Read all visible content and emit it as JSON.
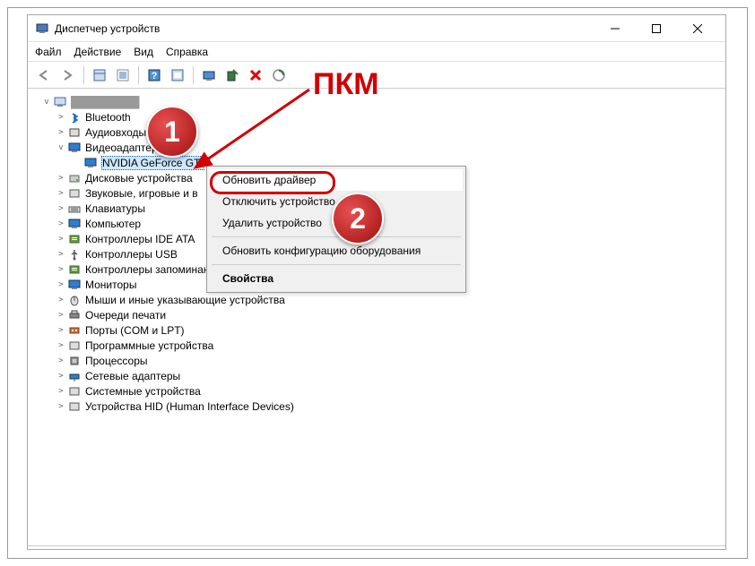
{
  "title": "Диспетчер устройств",
  "menus": {
    "file": "Файл",
    "action": "Действие",
    "view": "Вид",
    "help": "Справка"
  },
  "toolbar": {
    "back": "←",
    "forward": "→",
    "icons": [
      "props",
      "scan",
      "help",
      "show",
      "monitor",
      "install",
      "delete",
      "scan2"
    ]
  },
  "tree": {
    "root": "",
    "items": [
      {
        "label": "Bluetooth",
        "expanded": false,
        "icon": "bluetooth"
      },
      {
        "label": "Аудиовходы",
        "expanded": false,
        "icon": "audio",
        "trail": "ды"
      },
      {
        "label": "Видеоадаптеры",
        "expanded": true,
        "icon": "display",
        "children": [
          {
            "label": "NVIDIA GeForce GT",
            "icon": "display",
            "selected": true
          }
        ]
      },
      {
        "label": "Дисковые устройства",
        "expanded": false,
        "icon": "disk"
      },
      {
        "label": "Звуковые, игровые и в",
        "expanded": false,
        "icon": "sound"
      },
      {
        "label": "Клавиатуры",
        "expanded": false,
        "icon": "keyboard"
      },
      {
        "label": "Компьютер",
        "expanded": false,
        "icon": "computer"
      },
      {
        "label": "Контроллеры IDE ATA",
        "expanded": false,
        "icon": "ide"
      },
      {
        "label": "Контроллеры USB",
        "expanded": false,
        "icon": "usb"
      },
      {
        "label": "Контроллеры запоминающих устройств",
        "expanded": false,
        "icon": "storage"
      },
      {
        "label": "Мониторы",
        "expanded": false,
        "icon": "monitor"
      },
      {
        "label": "Мыши и иные указывающие устройства",
        "expanded": false,
        "icon": "mouse"
      },
      {
        "label": "Очереди печати",
        "expanded": false,
        "icon": "printer"
      },
      {
        "label": "Порты (COM и LPT)",
        "expanded": false,
        "icon": "port"
      },
      {
        "label": "Программные устройства",
        "expanded": false,
        "icon": "software"
      },
      {
        "label": "Процессоры",
        "expanded": false,
        "icon": "cpu"
      },
      {
        "label": "Сетевые адаптеры",
        "expanded": false,
        "icon": "network"
      },
      {
        "label": "Системные устройства",
        "expanded": false,
        "icon": "system"
      },
      {
        "label": "Устройства HID (Human Interface Devices)",
        "expanded": false,
        "icon": "hid"
      }
    ]
  },
  "context_menu": {
    "items": [
      "Обновить драйвер",
      "Отключить устройство",
      "Удалить устройство",
      "Обновить конфигурацию оборудования",
      "Свойства"
    ],
    "highlighted": 0,
    "separators_after": [
      2,
      3
    ]
  },
  "annotations": {
    "label": "ПКМ",
    "callouts": [
      "1",
      "2"
    ]
  },
  "icon_colors": {
    "bluetooth": "#0a66c2",
    "audio": "#444",
    "display": "#2a7fd4",
    "disk": "#888",
    "sound": "#555",
    "keyboard": "#555",
    "computer": "#2a7fd4",
    "ide": "#6a9c3a",
    "usb": "#555",
    "storage": "#6a9c3a",
    "monitor": "#2a7fd4",
    "mouse": "#555",
    "printer": "#555",
    "port": "#c47a1a",
    "software": "#555",
    "cpu": "#555",
    "network": "#2a7fd4",
    "system": "#555",
    "hid": "#555"
  }
}
